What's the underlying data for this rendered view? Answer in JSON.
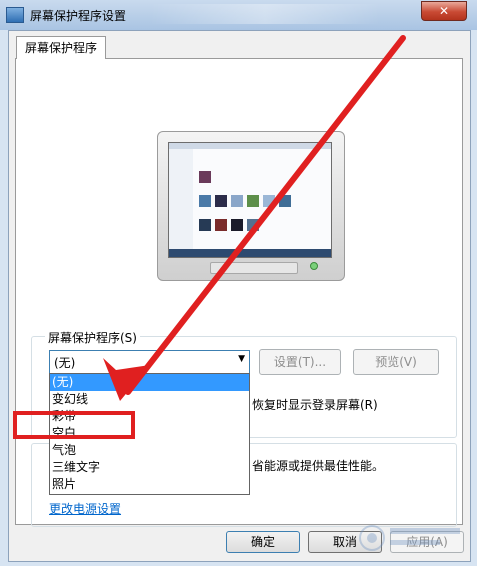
{
  "window": {
    "title": "屏幕保护程序设置",
    "close_symbol": "✕"
  },
  "tab": {
    "label": "屏幕保护程序"
  },
  "screensaver": {
    "group_label": "屏幕保护程序(S)",
    "selected": "(无)",
    "settings_label": "设置(T)...",
    "preview_label": "预览(V)",
    "resume_text": "恢复时显示登录屏幕(R)",
    "options": [
      "(无)",
      "变幻线",
      "彩带",
      "空白",
      "气泡",
      "三维文字",
      "照片"
    ]
  },
  "power": {
    "description": "省能源或提供最佳性能。",
    "link": "更改电源设置"
  },
  "buttons": {
    "ok": "确定",
    "cancel": "取消",
    "apply": "应用(A)"
  },
  "annotation": {
    "color": "#e02020"
  }
}
